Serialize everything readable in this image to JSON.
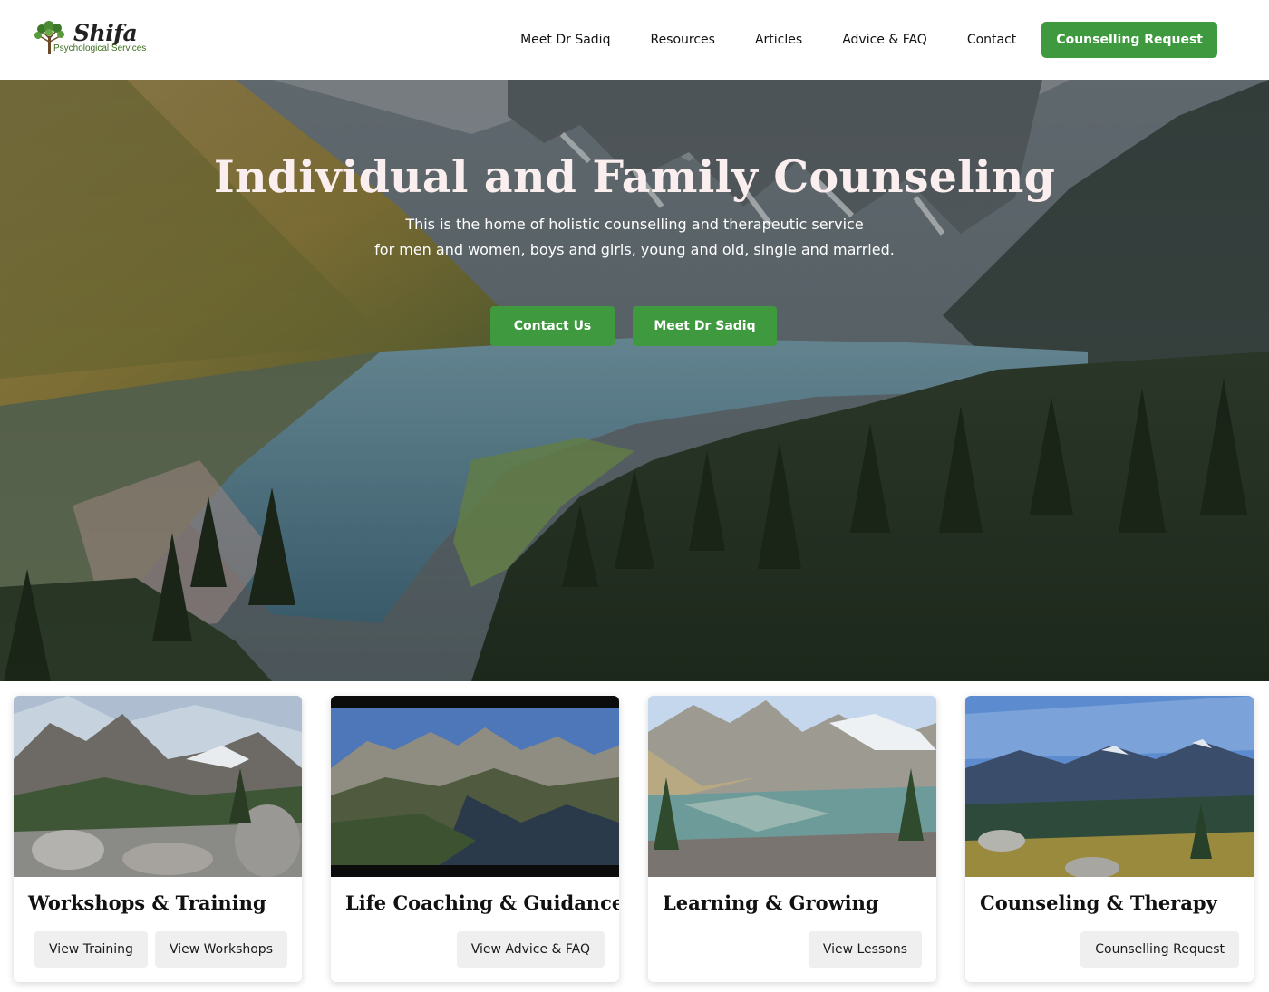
{
  "logo": {
    "name": "Shifa",
    "subtitle": "Psychological Services"
  },
  "nav": {
    "items": [
      {
        "label": "Meet Dr Sadiq"
      },
      {
        "label": "Resources"
      },
      {
        "label": "Articles"
      },
      {
        "label": "Advice & FAQ"
      },
      {
        "label": "Contact"
      }
    ],
    "cta_label": "Counselling Request"
  },
  "hero": {
    "title": "Individual and Family Counseling",
    "line1": "This is the home of holistic counselling and therapeutic service",
    "line2": "for men and women, boys and girls, young and old, single and married.",
    "buttons": [
      {
        "label": "Contact Us"
      },
      {
        "label": "Meet Dr Sadiq"
      }
    ]
  },
  "cards": [
    {
      "title": "Workshops & Training",
      "buttons": [
        "View Training",
        "View Workshops"
      ]
    },
    {
      "title": "Life Coaching & Guidance",
      "buttons": [
        "View Advice & FAQ"
      ]
    },
    {
      "title": "Learning & Growing",
      "buttons": [
        "View Lessons"
      ]
    },
    {
      "title": "Counseling & Therapy",
      "buttons": [
        "Counselling Request"
      ]
    }
  ],
  "colors": {
    "primary_green": "#3f9a3f",
    "hero_title": "#fbeeee",
    "card_button_bg": "#efefef"
  }
}
